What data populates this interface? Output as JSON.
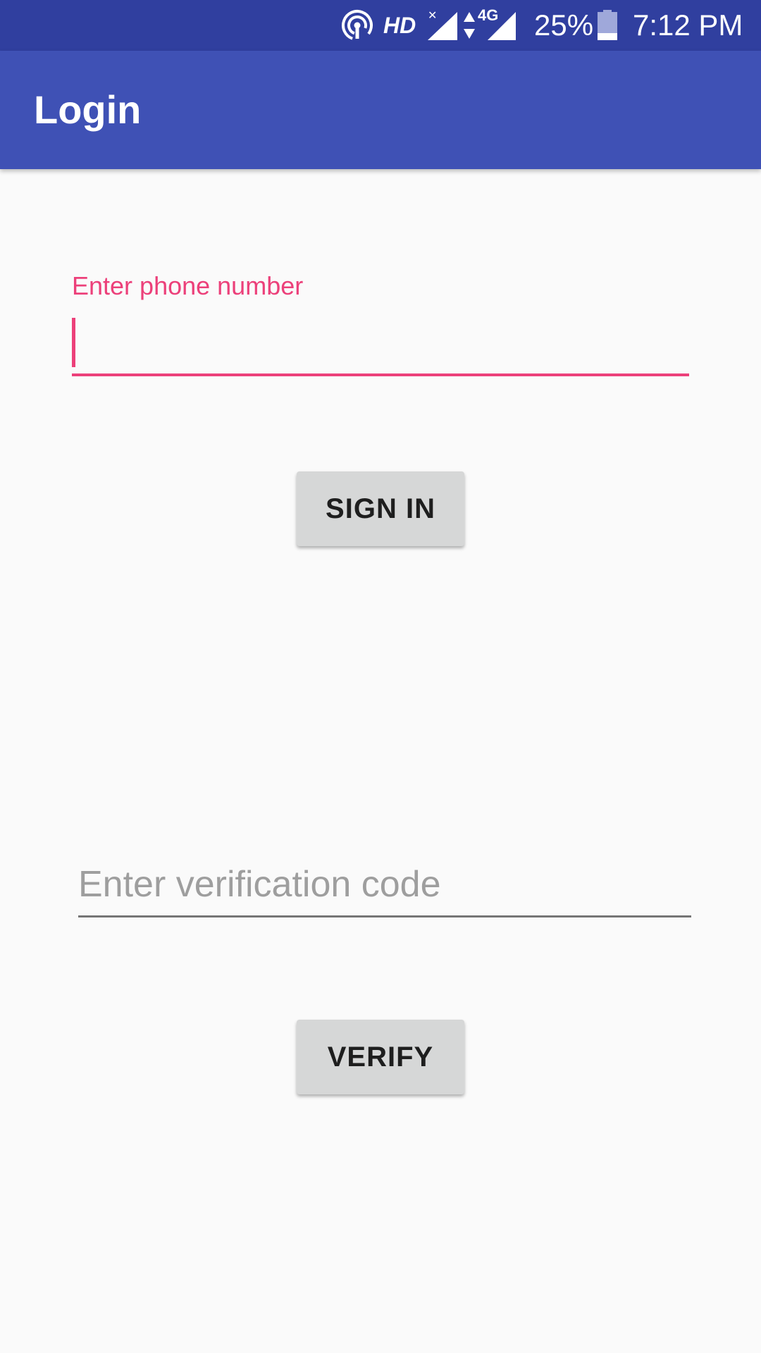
{
  "status_bar": {
    "hd_label": "HD",
    "network_label": "4G",
    "battery_percent": "25%",
    "battery_level": 0.25,
    "time": "7:12 PM",
    "icons": [
      "hotspot-icon",
      "signal-icon",
      "data-arrows-icon",
      "battery-icon"
    ],
    "background_color": "#303f9f"
  },
  "toolbar": {
    "title": "Login",
    "background_color": "#3f51b5"
  },
  "phone": {
    "label": "Enter phone number",
    "value": "",
    "accent_color": "#ec407a"
  },
  "sign_in": {
    "label": "SIGN IN"
  },
  "verification": {
    "placeholder": "Enter verification code",
    "value": ""
  },
  "verify": {
    "label": "VERIFY"
  }
}
